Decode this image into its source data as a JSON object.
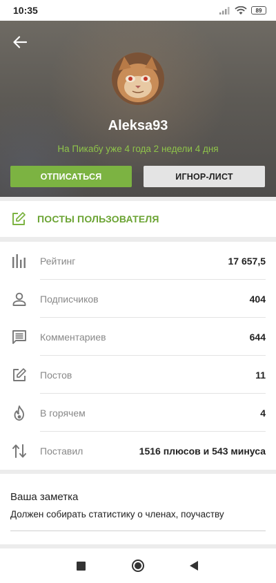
{
  "status_bar": {
    "time": "10:35",
    "battery": "89"
  },
  "profile": {
    "username": "Aleksa93",
    "since": "На Пикабу уже 4 года 2 недели 4 дня",
    "unsubscribe_label": "ОТПИСАТЬСЯ",
    "ignore_label": "ИГНОР-ЛИСТ"
  },
  "posts": {
    "label": "ПОСТЫ ПОЛЬЗОВАТЕЛЯ"
  },
  "stats": [
    {
      "label": "Рейтинг",
      "value": "17 657,5",
      "icon": "rating-bars-icon"
    },
    {
      "label": "Подписчиков",
      "value": "404",
      "icon": "person-icon"
    },
    {
      "label": "Комментариев",
      "value": "644",
      "icon": "comment-icon"
    },
    {
      "label": "Постов",
      "value": "11",
      "icon": "edit-icon"
    },
    {
      "label": "В горячем",
      "value": "4",
      "icon": "fire-icon"
    },
    {
      "label": "Поставил",
      "value": "1516 плюсов и 543 минуса",
      "icon": "up-down-arrows-icon"
    }
  ],
  "note": {
    "title": "Ваша заметка",
    "text": "Должен собирать статистику о членах, поучаству"
  },
  "colors": {
    "accent": "#7cb342",
    "accent_text": "#6aa332",
    "since_text": "#8fc44a"
  }
}
